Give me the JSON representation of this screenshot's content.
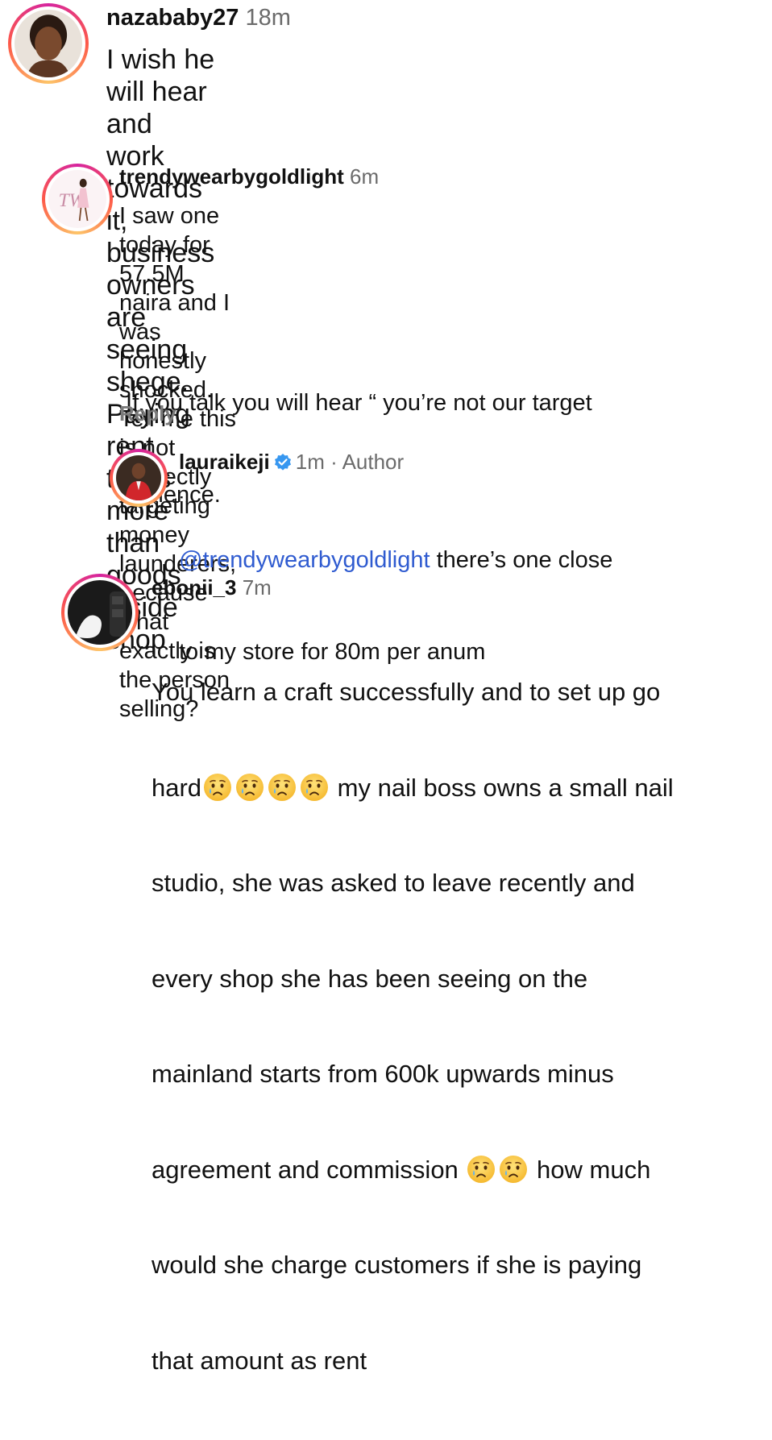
{
  "comments": [
    {
      "username": "nazababy27",
      "time": "18m",
      "lines": [
        "I wish he will hear and work towards it,",
        "business owners are seeing shege. Paying rent",
        "that's more than goods inside shop"
      ]
    },
    {
      "username": "trendywearbygoldlight",
      "time": "6m",
      "lines": [
        "I saw one today for 57.5M naira and I was",
        "honestly shocked. Tell me this is not indirectly",
        "targeting money launderers, because what",
        "exactly is the person selling?"
      ],
      "lines2": [
        " If you talk you will hear “ you’re not our target",
        "audience."
      ],
      "reply_label": "Reply"
    },
    {
      "username": "lauraikeji",
      "time": "1m",
      "separator": "·",
      "author_label": "Author",
      "mention": "@trendywearbygoldlight",
      "line1_rest": " there’s one close",
      "line2": "to my store for 80m per anum"
    },
    {
      "username": "ebonii_3",
      "time": "7m",
      "line1": "You learn a craft successfully and to set up go",
      "line2_a": "hard",
      "line2_b": " my nail boss owns a small nail",
      "line3": "studio, she was asked to leave recently and",
      "line4": "every shop she has been seeing on the",
      "line5": "mainland starts from 600k upwards minus",
      "line6_a": "agreement and commission ",
      "line6_b": " how much",
      "line7": "would she charge customers if she is paying",
      "line8": "that amount as rent"
    }
  ],
  "colors": {
    "mention": "#2f5bd0",
    "verified": "#3797f0",
    "muted": "#6b6b6b"
  },
  "icons": {
    "verified": "verified-badge-icon",
    "emoji": "crying-face-emoji"
  }
}
